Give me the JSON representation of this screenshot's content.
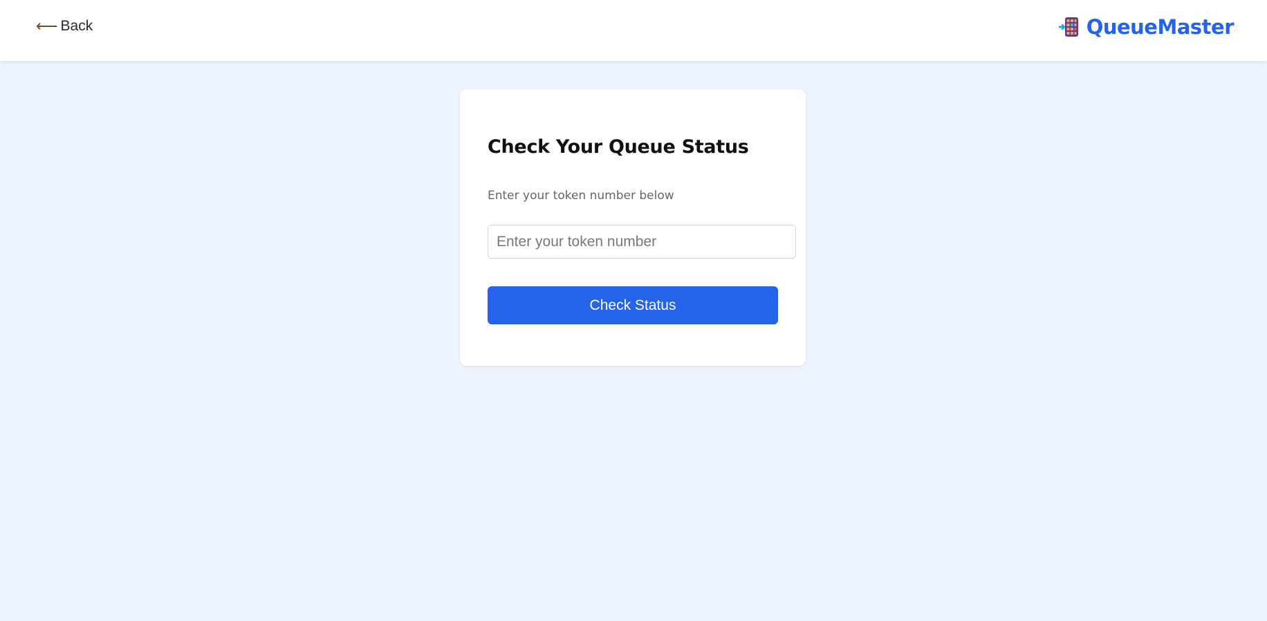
{
  "header": {
    "back_label": "Back",
    "back_icon": "left-arrow-icon",
    "brand_name": "QueueMaster",
    "brand_icon": "queue-board-icon"
  },
  "card": {
    "title": "Check Your Queue Status",
    "subtitle": "Enter your token number below",
    "input_placeholder": "Enter your token number",
    "input_value": "",
    "button_label": "Check Status"
  },
  "colors": {
    "accent": "#2563eb",
    "page_background": "#eef4fe",
    "card_background": "#ffffff"
  }
}
